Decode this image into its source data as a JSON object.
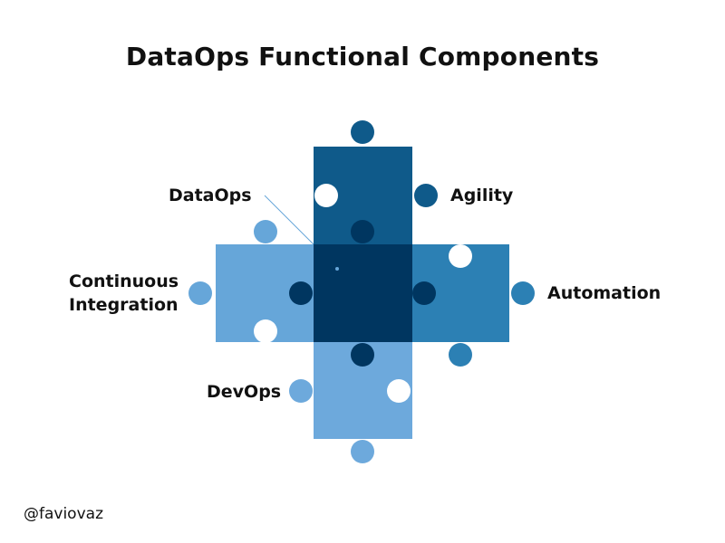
{
  "title": "DataOps Functional Components",
  "labels": {
    "dataops": "DataOps",
    "agility": "Agility",
    "automation": "Automation",
    "ci_line1": "Continuous",
    "ci_line2": "Integration",
    "devops": "DevOps"
  },
  "credit": "@faviovaz",
  "colors": {
    "center": "#003660",
    "top": "#0f5a8a",
    "right": "#2c80b4",
    "left": "#66a6d9",
    "bottom": "#6da9dc",
    "pointer": "#66a6d9"
  }
}
